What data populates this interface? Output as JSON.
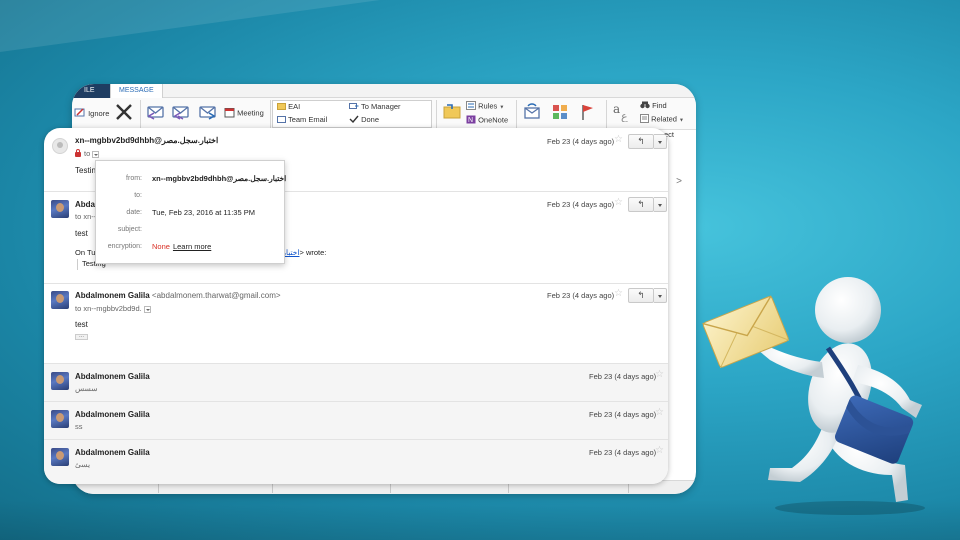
{
  "ribbon": {
    "tab_file": "ILE",
    "tab_message": "MESSAGE",
    "ignore": "Ignore",
    "meeting": "Meeting",
    "quick_steps": [
      "EAI",
      "Team Email",
      "To Manager",
      "Done"
    ],
    "rules": "Rules",
    "onenote": "OneNote",
    "find": "Find",
    "related": "Related",
    "select_partial": "ect",
    "right_chevron": ">"
  },
  "gmail": {
    "messages": [
      {
        "sender": "xn--mgbbv2bd9dhbh@اختبار.سجل.مصر",
        "to": "to",
        "date": "Feb 23 (4 days ago)",
        "body": "Testing"
      },
      {
        "sender": "Abdal",
        "to": "to xn--",
        "date": "Feb 23 (4 days ago)",
        "body": "test",
        "quote_prefix": "On Tu",
        "quote_link": "اختبار.سجل",
        "quote_suffix": "> wrote:",
        "quoted_text": "Testing"
      },
      {
        "sender": "Abdalmonem Galila",
        "sender_email": "<abdalmonem.tharwat@gmail.com>",
        "to": "to xn--mgbbv2bd9d.",
        "date": "Feb 23 (4 days ago)",
        "body": "test",
        "ellipsis": "..."
      },
      {
        "sender": "Abdalmonem Galila",
        "date": "Feb 23 (4 days ago)",
        "snippet": "سسس"
      },
      {
        "sender": "Abdalmonem Galila",
        "date": "Feb 23 (4 days ago)",
        "snippet": "ss"
      },
      {
        "sender": "Abdalmonem Galila",
        "date": "Feb 23 (4 days ago)",
        "snippet": "يسئ"
      }
    ],
    "popup": {
      "from_label": "from:",
      "from_value": "xn--mgbbv2bd9dhbh@اختبار.سجل.مصر",
      "to_label": "to:",
      "date_label": "date:",
      "date_value": "Tue, Feb 23, 2016 at 11:35 PM",
      "subject_label": "subject:",
      "encryption_label": "encryption:",
      "encryption_value": "None",
      "learn_more": "Learn more"
    },
    "reply_icon": "reply-arrow-icon",
    "star_icon": "star-outline-icon"
  },
  "colors": {
    "background": "#2ca6c6",
    "outlook_tab_accent": "#2a6bb5",
    "file_tab": "#1f3d62",
    "encryption_none": "#d93025"
  }
}
